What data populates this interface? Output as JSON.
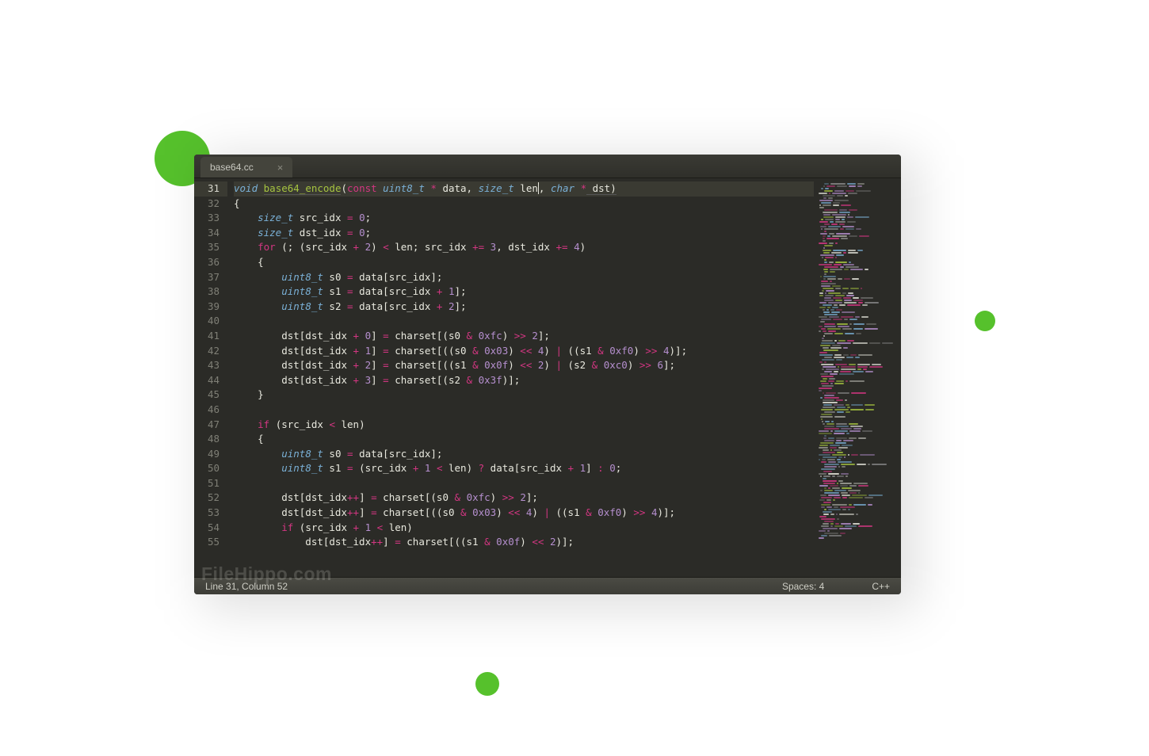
{
  "tab": {
    "filename": "base64.cc",
    "close": "×"
  },
  "gutter": {
    "start": 31,
    "end": 55,
    "highlighted": 31
  },
  "code": {
    "lines": [
      [
        {
          "c": "kw-type",
          "t": "void "
        },
        {
          "c": "fn under",
          "t": "base64_encode"
        },
        {
          "c": "punct",
          "t": "("
        },
        {
          "c": "kw-mod",
          "t": "const "
        },
        {
          "c": "kw-type",
          "t": "uint8_t"
        },
        {
          "c": "plain",
          "t": " "
        },
        {
          "c": "op",
          "t": "*"
        },
        {
          "c": "plain",
          "t": " data, "
        },
        {
          "c": "kw-type",
          "t": "size_t"
        },
        {
          "c": "plain",
          "t": " len"
        },
        {
          "c": "cursor",
          "t": ""
        },
        {
          "c": "plain",
          "t": ", "
        },
        {
          "c": "kw-type",
          "t": "char"
        },
        {
          "c": "plain",
          "t": " "
        },
        {
          "c": "op",
          "t": "*"
        },
        {
          "c": "plain under",
          "t": " dst)"
        }
      ],
      [
        {
          "c": "punct",
          "t": "{"
        }
      ],
      [
        {
          "c": "plain",
          "t": "    "
        },
        {
          "c": "kw-type",
          "t": "size_t"
        },
        {
          "c": "plain",
          "t": " src_idx "
        },
        {
          "c": "op",
          "t": "="
        },
        {
          "c": "plain",
          "t": " "
        },
        {
          "c": "num",
          "t": "0"
        },
        {
          "c": "punct",
          "t": ";"
        }
      ],
      [
        {
          "c": "plain",
          "t": "    "
        },
        {
          "c": "kw-type",
          "t": "size_t"
        },
        {
          "c": "plain",
          "t": " dst_idx "
        },
        {
          "c": "op",
          "t": "="
        },
        {
          "c": "plain",
          "t": " "
        },
        {
          "c": "num",
          "t": "0"
        },
        {
          "c": "punct",
          "t": ";"
        }
      ],
      [
        {
          "c": "plain",
          "t": "    "
        },
        {
          "c": "kw-mod",
          "t": "for"
        },
        {
          "c": "plain",
          "t": " (; (src_idx "
        },
        {
          "c": "op",
          "t": "+"
        },
        {
          "c": "plain",
          "t": " "
        },
        {
          "c": "num",
          "t": "2"
        },
        {
          "c": "plain",
          "t": ") "
        },
        {
          "c": "op",
          "t": "<"
        },
        {
          "c": "plain",
          "t": " len; src_idx "
        },
        {
          "c": "op",
          "t": "+="
        },
        {
          "c": "plain",
          "t": " "
        },
        {
          "c": "num",
          "t": "3"
        },
        {
          "c": "plain",
          "t": ", dst_idx "
        },
        {
          "c": "op",
          "t": "+="
        },
        {
          "c": "plain",
          "t": " "
        },
        {
          "c": "num",
          "t": "4"
        },
        {
          "c": "plain",
          "t": ")"
        }
      ],
      [
        {
          "c": "plain",
          "t": "    {"
        }
      ],
      [
        {
          "c": "plain",
          "t": "        "
        },
        {
          "c": "kw-type",
          "t": "uint8_t"
        },
        {
          "c": "plain",
          "t": " s0 "
        },
        {
          "c": "op",
          "t": "="
        },
        {
          "c": "plain",
          "t": " data[src_idx];"
        }
      ],
      [
        {
          "c": "plain",
          "t": "        "
        },
        {
          "c": "kw-type",
          "t": "uint8_t"
        },
        {
          "c": "plain",
          "t": " s1 "
        },
        {
          "c": "op",
          "t": "="
        },
        {
          "c": "plain",
          "t": " data[src_idx "
        },
        {
          "c": "op",
          "t": "+"
        },
        {
          "c": "plain",
          "t": " "
        },
        {
          "c": "num",
          "t": "1"
        },
        {
          "c": "plain",
          "t": "];"
        }
      ],
      [
        {
          "c": "plain",
          "t": "        "
        },
        {
          "c": "kw-type",
          "t": "uint8_t"
        },
        {
          "c": "plain",
          "t": " s2 "
        },
        {
          "c": "op",
          "t": "="
        },
        {
          "c": "plain",
          "t": " data[src_idx "
        },
        {
          "c": "op",
          "t": "+"
        },
        {
          "c": "plain",
          "t": " "
        },
        {
          "c": "num",
          "t": "2"
        },
        {
          "c": "plain",
          "t": "];"
        }
      ],
      [
        {
          "c": "plain",
          "t": ""
        }
      ],
      [
        {
          "c": "plain",
          "t": "        dst[dst_idx "
        },
        {
          "c": "op",
          "t": "+"
        },
        {
          "c": "plain",
          "t": " "
        },
        {
          "c": "num",
          "t": "0"
        },
        {
          "c": "plain",
          "t": "] "
        },
        {
          "c": "op",
          "t": "="
        },
        {
          "c": "plain",
          "t": " charset[(s0 "
        },
        {
          "c": "op",
          "t": "&"
        },
        {
          "c": "plain",
          "t": " "
        },
        {
          "c": "num",
          "t": "0xfc"
        },
        {
          "c": "plain",
          "t": ") "
        },
        {
          "c": "op",
          "t": ">>"
        },
        {
          "c": "plain",
          "t": " "
        },
        {
          "c": "num",
          "t": "2"
        },
        {
          "c": "plain",
          "t": "];"
        }
      ],
      [
        {
          "c": "plain",
          "t": "        dst[dst_idx "
        },
        {
          "c": "op",
          "t": "+"
        },
        {
          "c": "plain",
          "t": " "
        },
        {
          "c": "num",
          "t": "1"
        },
        {
          "c": "plain",
          "t": "] "
        },
        {
          "c": "op",
          "t": "="
        },
        {
          "c": "plain",
          "t": " charset[((s0 "
        },
        {
          "c": "op",
          "t": "&"
        },
        {
          "c": "plain",
          "t": " "
        },
        {
          "c": "num",
          "t": "0x03"
        },
        {
          "c": "plain",
          "t": ") "
        },
        {
          "c": "op",
          "t": "<<"
        },
        {
          "c": "plain",
          "t": " "
        },
        {
          "c": "num",
          "t": "4"
        },
        {
          "c": "plain",
          "t": ") "
        },
        {
          "c": "op",
          "t": "|"
        },
        {
          "c": "plain",
          "t": " ((s1 "
        },
        {
          "c": "op",
          "t": "&"
        },
        {
          "c": "plain",
          "t": " "
        },
        {
          "c": "num",
          "t": "0xf0"
        },
        {
          "c": "plain",
          "t": ") "
        },
        {
          "c": "op",
          "t": ">>"
        },
        {
          "c": "plain",
          "t": " "
        },
        {
          "c": "num",
          "t": "4"
        },
        {
          "c": "plain",
          "t": ")];"
        }
      ],
      [
        {
          "c": "plain",
          "t": "        dst[dst_idx "
        },
        {
          "c": "op",
          "t": "+"
        },
        {
          "c": "plain",
          "t": " "
        },
        {
          "c": "num",
          "t": "2"
        },
        {
          "c": "plain",
          "t": "] "
        },
        {
          "c": "op",
          "t": "="
        },
        {
          "c": "plain",
          "t": " charset[((s1 "
        },
        {
          "c": "op",
          "t": "&"
        },
        {
          "c": "plain",
          "t": " "
        },
        {
          "c": "num",
          "t": "0x0f"
        },
        {
          "c": "plain",
          "t": ") "
        },
        {
          "c": "op",
          "t": "<<"
        },
        {
          "c": "plain",
          "t": " "
        },
        {
          "c": "num",
          "t": "2"
        },
        {
          "c": "plain",
          "t": ") "
        },
        {
          "c": "op",
          "t": "|"
        },
        {
          "c": "plain",
          "t": " (s2 "
        },
        {
          "c": "op",
          "t": "&"
        },
        {
          "c": "plain",
          "t": " "
        },
        {
          "c": "num",
          "t": "0xc0"
        },
        {
          "c": "plain",
          "t": ") "
        },
        {
          "c": "op",
          "t": ">>"
        },
        {
          "c": "plain",
          "t": " "
        },
        {
          "c": "num",
          "t": "6"
        },
        {
          "c": "plain",
          "t": "];"
        }
      ],
      [
        {
          "c": "plain",
          "t": "        dst[dst_idx "
        },
        {
          "c": "op",
          "t": "+"
        },
        {
          "c": "plain",
          "t": " "
        },
        {
          "c": "num",
          "t": "3"
        },
        {
          "c": "plain",
          "t": "] "
        },
        {
          "c": "op",
          "t": "="
        },
        {
          "c": "plain",
          "t": " charset[(s2 "
        },
        {
          "c": "op",
          "t": "&"
        },
        {
          "c": "plain",
          "t": " "
        },
        {
          "c": "num",
          "t": "0x3f"
        },
        {
          "c": "plain",
          "t": ")];"
        }
      ],
      [
        {
          "c": "plain",
          "t": "    }"
        }
      ],
      [
        {
          "c": "plain",
          "t": ""
        }
      ],
      [
        {
          "c": "plain",
          "t": "    "
        },
        {
          "c": "kw-mod",
          "t": "if"
        },
        {
          "c": "plain",
          "t": " (src_idx "
        },
        {
          "c": "op",
          "t": "<"
        },
        {
          "c": "plain",
          "t": " len)"
        }
      ],
      [
        {
          "c": "plain",
          "t": "    {"
        }
      ],
      [
        {
          "c": "plain",
          "t": "        "
        },
        {
          "c": "kw-type",
          "t": "uint8_t"
        },
        {
          "c": "plain",
          "t": " s0 "
        },
        {
          "c": "op",
          "t": "="
        },
        {
          "c": "plain",
          "t": " data[src_idx];"
        }
      ],
      [
        {
          "c": "plain",
          "t": "        "
        },
        {
          "c": "kw-type",
          "t": "uint8_t"
        },
        {
          "c": "plain",
          "t": " s1 "
        },
        {
          "c": "op",
          "t": "="
        },
        {
          "c": "plain",
          "t": " (src_idx "
        },
        {
          "c": "op",
          "t": "+"
        },
        {
          "c": "plain",
          "t": " "
        },
        {
          "c": "num",
          "t": "1"
        },
        {
          "c": "plain",
          "t": " "
        },
        {
          "c": "op",
          "t": "<"
        },
        {
          "c": "plain",
          "t": " len) "
        },
        {
          "c": "op",
          "t": "?"
        },
        {
          "c": "plain",
          "t": " data[src_idx "
        },
        {
          "c": "op",
          "t": "+"
        },
        {
          "c": "plain",
          "t": " "
        },
        {
          "c": "num",
          "t": "1"
        },
        {
          "c": "plain",
          "t": "] "
        },
        {
          "c": "op",
          "t": ":"
        },
        {
          "c": "plain",
          "t": " "
        },
        {
          "c": "num",
          "t": "0"
        },
        {
          "c": "plain",
          "t": ";"
        }
      ],
      [
        {
          "c": "plain",
          "t": ""
        }
      ],
      [
        {
          "c": "plain",
          "t": "        dst[dst_idx"
        },
        {
          "c": "op",
          "t": "++"
        },
        {
          "c": "plain",
          "t": "] "
        },
        {
          "c": "op",
          "t": "="
        },
        {
          "c": "plain",
          "t": " charset[(s0 "
        },
        {
          "c": "op",
          "t": "&"
        },
        {
          "c": "plain",
          "t": " "
        },
        {
          "c": "num",
          "t": "0xfc"
        },
        {
          "c": "plain",
          "t": ") "
        },
        {
          "c": "op",
          "t": ">>"
        },
        {
          "c": "plain",
          "t": " "
        },
        {
          "c": "num",
          "t": "2"
        },
        {
          "c": "plain",
          "t": "];"
        }
      ],
      [
        {
          "c": "plain",
          "t": "        dst[dst_idx"
        },
        {
          "c": "op",
          "t": "++"
        },
        {
          "c": "plain",
          "t": "] "
        },
        {
          "c": "op",
          "t": "="
        },
        {
          "c": "plain",
          "t": " charset[((s0 "
        },
        {
          "c": "op",
          "t": "&"
        },
        {
          "c": "plain",
          "t": " "
        },
        {
          "c": "num",
          "t": "0x03"
        },
        {
          "c": "plain",
          "t": ") "
        },
        {
          "c": "op",
          "t": "<<"
        },
        {
          "c": "plain",
          "t": " "
        },
        {
          "c": "num",
          "t": "4"
        },
        {
          "c": "plain",
          "t": ") "
        },
        {
          "c": "op",
          "t": "|"
        },
        {
          "c": "plain",
          "t": " ((s1 "
        },
        {
          "c": "op",
          "t": "&"
        },
        {
          "c": "plain",
          "t": " "
        },
        {
          "c": "num",
          "t": "0xf0"
        },
        {
          "c": "plain",
          "t": ") "
        },
        {
          "c": "op",
          "t": ">>"
        },
        {
          "c": "plain",
          "t": " "
        },
        {
          "c": "num",
          "t": "4"
        },
        {
          "c": "plain",
          "t": ")];"
        }
      ],
      [
        {
          "c": "plain",
          "t": "        "
        },
        {
          "c": "kw-mod",
          "t": "if"
        },
        {
          "c": "plain",
          "t": " (src_idx "
        },
        {
          "c": "op",
          "t": "+"
        },
        {
          "c": "plain",
          "t": " "
        },
        {
          "c": "num",
          "t": "1"
        },
        {
          "c": "plain",
          "t": " "
        },
        {
          "c": "op",
          "t": "<"
        },
        {
          "c": "plain",
          "t": " len)"
        }
      ],
      [
        {
          "c": "plain",
          "t": "            dst[dst_idx"
        },
        {
          "c": "op",
          "t": "++"
        },
        {
          "c": "plain",
          "t": "] "
        },
        {
          "c": "op",
          "t": "="
        },
        {
          "c": "plain",
          "t": " charset[((s1 "
        },
        {
          "c": "op",
          "t": "&"
        },
        {
          "c": "plain",
          "t": " "
        },
        {
          "c": "num",
          "t": "0x0f"
        },
        {
          "c": "plain",
          "t": ") "
        },
        {
          "c": "op",
          "t": "<<"
        },
        {
          "c": "plain",
          "t": " "
        },
        {
          "c": "num",
          "t": "2"
        },
        {
          "c": "plain",
          "t": ")];"
        }
      ]
    ]
  },
  "statusbar": {
    "left": "Line 31, Column 52",
    "spaces": "Spaces: 4",
    "lang": "C++"
  },
  "watermark": "FileHippo.com",
  "minimap_colors": [
    "#7ab0d6",
    "#a6c440",
    "#d33682",
    "#b58fce",
    "#e8e8de",
    "#888"
  ]
}
